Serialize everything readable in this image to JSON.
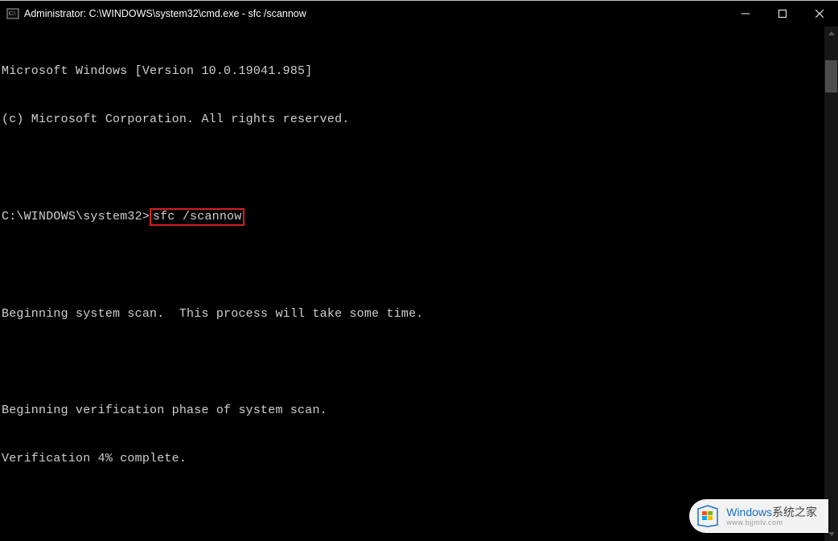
{
  "window": {
    "title": "Administrator: C:\\WINDOWS\\system32\\cmd.exe - sfc  /scannow"
  },
  "terminal": {
    "line1": "Microsoft Windows [Version 10.0.19041.985]",
    "line2": "(c) Microsoft Corporation. All rights reserved.",
    "prompt": "C:\\WINDOWS\\system32>",
    "command": "sfc /scannow",
    "line_scan": "Beginning system scan.  This process will take some time.",
    "line_verify": "Beginning verification phase of system scan.",
    "line_progress": "Verification 4% complete."
  },
  "watermark": {
    "brand": "Windows",
    "brand_cn": "系统之家",
    "url": "www.bjjmlv.com"
  }
}
